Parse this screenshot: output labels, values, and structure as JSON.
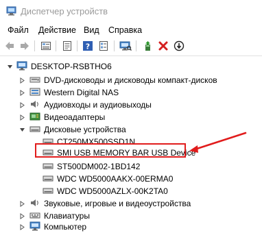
{
  "window": {
    "title": "Диспетчер устройств"
  },
  "menu": {
    "file": "Файл",
    "action": "Действие",
    "view": "Вид",
    "help": "Справка"
  },
  "toolbar": {
    "buttons": [
      "back-icon",
      "forward-icon",
      "device-view-icon",
      "properties-icon",
      "help-icon",
      "scan-hardware-icon",
      "update-driver-icon",
      "uninstall-icon",
      "disable-icon"
    ]
  },
  "tree": {
    "root": "DESKTOP-RSBTHO6",
    "items": {
      "dvd": "DVD-дисководы и дисководы компакт-дисков",
      "wdnas": "Western Digital NAS",
      "audio": "Аудиовходы и аудиовыходы",
      "video": "Видеоадаптеры",
      "disks": "Дисковые устройства",
      "sound": "Звуковые, игровые и видеоустройства",
      "keyboards": "Клавиатуры",
      "computer": "Компьютер"
    },
    "disks": [
      "CT250MX500SSD1N",
      "SMI USB MEMORY BAR USB Device",
      "ST500DM002-1BD142",
      "WDC WD5000AAKX-00ERMA0",
      "WDC WD5000AZLX-00K2TA0"
    ]
  },
  "highlight_color": "#e11c1c"
}
